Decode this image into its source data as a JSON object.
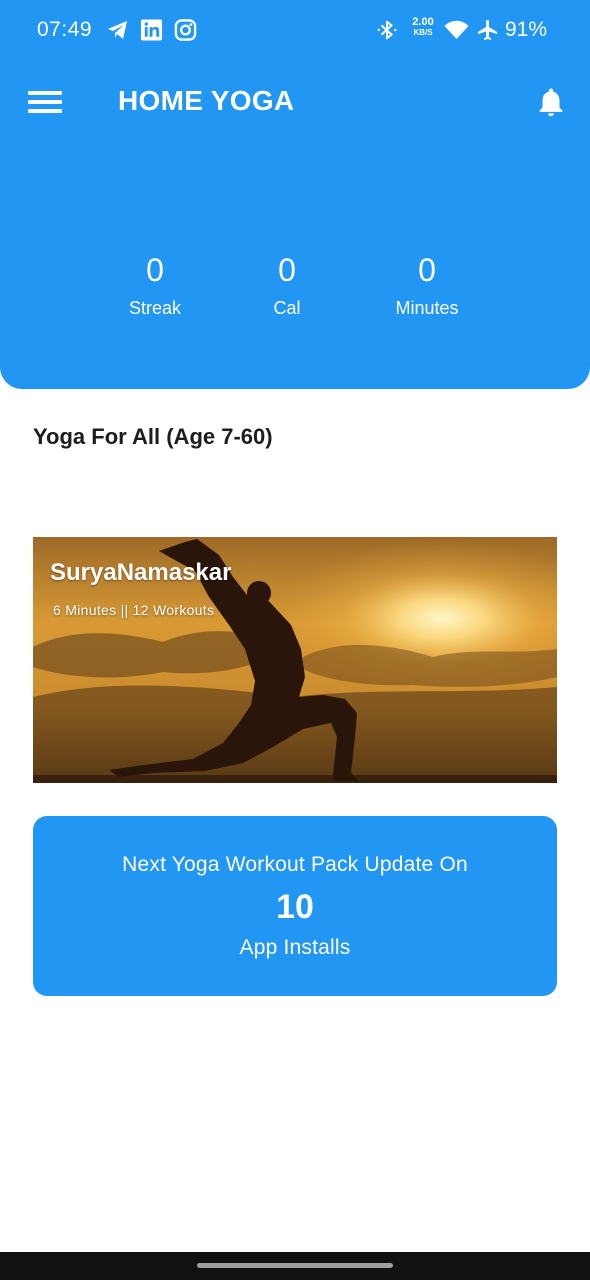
{
  "status_bar": {
    "time": "07:49",
    "data_rate_value": "2.00",
    "data_rate_unit": "KB/S",
    "battery": "91%",
    "icons": [
      "telegram-icon",
      "linkedin-icon",
      "instagram-icon",
      "bluetooth-icon",
      "wifi-icon",
      "airplane-icon"
    ]
  },
  "header": {
    "title": "HOME YOGA",
    "menu_icon": "hamburger-menu-icon",
    "notification_icon": "bell-icon",
    "background_color": "#2196f3"
  },
  "stats": [
    {
      "value": "0",
      "label": "Streak"
    },
    {
      "value": "0",
      "label": "Cal"
    },
    {
      "value": "0",
      "label": "Minutes"
    }
  ],
  "section": {
    "title": "Yoga For All (Age 7-60)"
  },
  "workout_card": {
    "title": "SuryaNamaskar",
    "subtitle": "6 Minutes || 12 Workouts"
  },
  "update_info": {
    "line1": "Next Yoga Workout Pack Update On",
    "number": "10",
    "line2": "App Installs"
  }
}
